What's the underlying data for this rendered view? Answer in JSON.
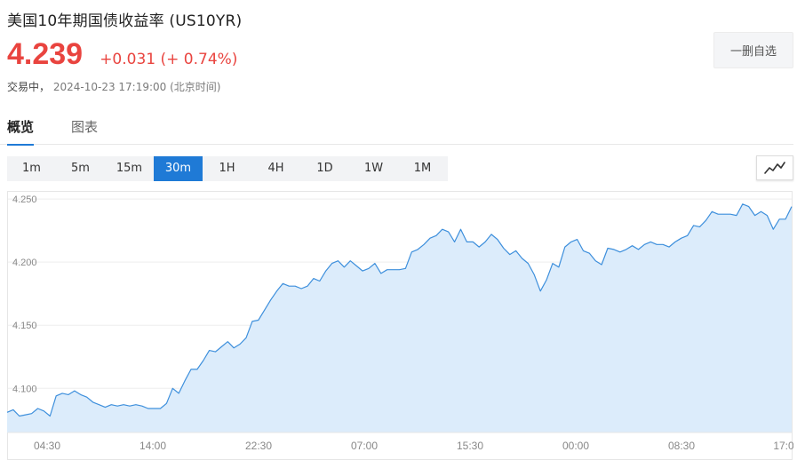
{
  "header": {
    "title": "美国10年期国债收益率  (US10YR)",
    "price": "4.239",
    "change": "+0.031 (+ 0.74%)",
    "status": "交易中，",
    "timestamp": "2024-10-23 17:19:00 (北京时间)",
    "watch_button": "一删自选"
  },
  "tabs": [
    {
      "label": "概览",
      "active": true
    },
    {
      "label": "图表",
      "active": false
    }
  ],
  "intervals": [
    {
      "label": "1m",
      "active": false
    },
    {
      "label": "5m",
      "active": false
    },
    {
      "label": "15m",
      "active": false
    },
    {
      "label": "30m",
      "active": true
    },
    {
      "label": "1H",
      "active": false
    },
    {
      "label": "4H",
      "active": false
    },
    {
      "label": "1D",
      "active": false
    },
    {
      "label": "1W",
      "active": false
    },
    {
      "label": "1M",
      "active": false
    }
  ],
  "chart_type_icon": "line-chart-icon",
  "colors": {
    "accent": "#1f7ad6",
    "price_up": "#e9443f",
    "line": "#3d8fdc",
    "area": "#dcecfb"
  },
  "chart_data": {
    "type": "area",
    "title": "",
    "xlabel": "",
    "ylabel": "",
    "ylim": [
      4.065,
      4.255
    ],
    "y_ticks": [
      "4.250",
      "4.200",
      "4.150",
      "4.100"
    ],
    "x_ticks": [
      "04:30",
      "14:00",
      "22:30",
      "07:00",
      "15:30",
      "00:00",
      "08:30",
      "17:0"
    ],
    "grid": "horizontal",
    "series": [
      {
        "values": [
          4.081,
          4.083,
          4.078,
          4.079,
          4.08,
          4.084,
          4.082,
          4.078,
          4.094,
          4.096,
          4.095,
          4.098,
          4.095,
          4.093,
          4.089,
          4.087,
          4.085,
          4.087,
          4.086,
          4.087,
          4.086,
          4.087,
          4.086,
          4.084,
          4.084,
          4.084,
          4.088,
          4.1,
          4.096,
          4.106,
          4.115,
          4.115,
          4.122,
          4.13,
          4.129,
          4.133,
          4.137,
          4.132,
          4.135,
          4.14,
          4.153,
          4.154,
          4.162,
          4.17,
          4.177,
          4.183,
          4.181,
          4.181,
          4.179,
          4.181,
          4.187,
          4.185,
          4.193,
          4.199,
          4.201,
          4.196,
          4.201,
          4.197,
          4.193,
          4.195,
          4.199,
          4.191,
          4.194,
          4.194,
          4.194,
          4.195,
          4.208,
          4.21,
          4.214,
          4.219,
          4.221,
          4.226,
          4.224,
          4.216,
          4.226,
          4.216,
          4.216,
          4.212,
          4.216,
          4.222,
          4.218,
          4.211,
          4.206,
          4.209,
          4.203,
          4.199,
          4.19,
          4.177,
          4.186,
          4.199,
          4.196,
          4.212,
          4.216,
          4.218,
          4.209,
          4.207,
          4.201,
          4.198,
          4.211,
          4.21,
          4.208,
          4.21,
          4.213,
          4.21,
          4.214,
          4.216,
          4.214,
          4.214,
          4.212,
          4.216,
          4.219,
          4.221,
          4.229,
          4.228,
          4.233,
          4.24,
          4.238,
          4.238,
          4.238,
          4.237,
          4.246,
          4.244,
          4.237,
          4.24,
          4.237,
          4.226,
          4.234,
          4.234,
          4.244
        ]
      }
    ]
  }
}
